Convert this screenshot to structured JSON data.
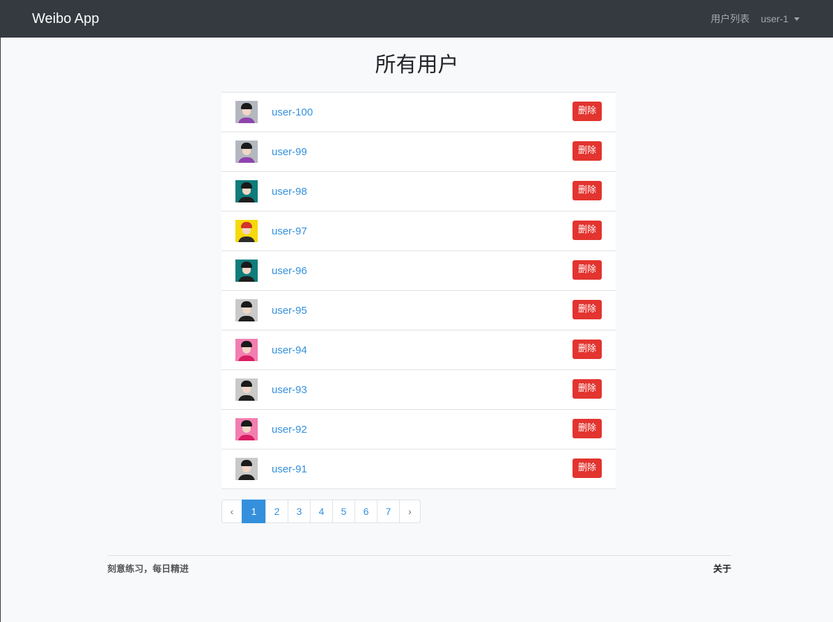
{
  "navbar": {
    "brand": "Weibo App",
    "user_list_link": "用户列表",
    "current_user": "user-1"
  },
  "page_title": "所有用户",
  "users": [
    {
      "name": "user-100",
      "delete_label": "删除",
      "avatar": {
        "bg": "#b3b8bf",
        "hair": "#1a1a1a",
        "body": "#8e44ad"
      }
    },
    {
      "name": "user-99",
      "delete_label": "删除",
      "avatar": {
        "bg": "#b3b8bf",
        "hair": "#1a1a1a",
        "body": "#8e44ad"
      }
    },
    {
      "name": "user-98",
      "delete_label": "删除",
      "avatar": {
        "bg": "#0e7c7b",
        "hair": "#1a1a1a",
        "body": "#1f1f1f"
      }
    },
    {
      "name": "user-97",
      "delete_label": "删除",
      "avatar": {
        "bg": "#f5d90a",
        "hair": "#d0342c",
        "body": "#2c2c2c"
      }
    },
    {
      "name": "user-96",
      "delete_label": "删除",
      "avatar": {
        "bg": "#0e7c7b",
        "hair": "#1a1a1a",
        "body": "#1f1f1f"
      }
    },
    {
      "name": "user-95",
      "delete_label": "删除",
      "avatar": {
        "bg": "#c9c9c9",
        "hair": "#1a1a1a",
        "body": "#1f1f1f"
      }
    },
    {
      "name": "user-94",
      "delete_label": "删除",
      "avatar": {
        "bg": "#f27eb0",
        "hair": "#1a1a1a",
        "body": "#d91e63"
      }
    },
    {
      "name": "user-93",
      "delete_label": "删除",
      "avatar": {
        "bg": "#c9c9c9",
        "hair": "#1a1a1a",
        "body": "#1f1f1f"
      }
    },
    {
      "name": "user-92",
      "delete_label": "删除",
      "avatar": {
        "bg": "#f27eb0",
        "hair": "#1a1a1a",
        "body": "#d91e63"
      }
    },
    {
      "name": "user-91",
      "delete_label": "删除",
      "avatar": {
        "bg": "#c9c9c9",
        "hair": "#1a1a1a",
        "body": "#1f1f1f"
      }
    }
  ],
  "pagination": {
    "prev": "‹",
    "pages": [
      "1",
      "2",
      "3",
      "4",
      "5",
      "6",
      "7"
    ],
    "active": "1",
    "next": "›"
  },
  "footer": {
    "slogan": "刻意练习，每日精进",
    "about": "关于"
  }
}
